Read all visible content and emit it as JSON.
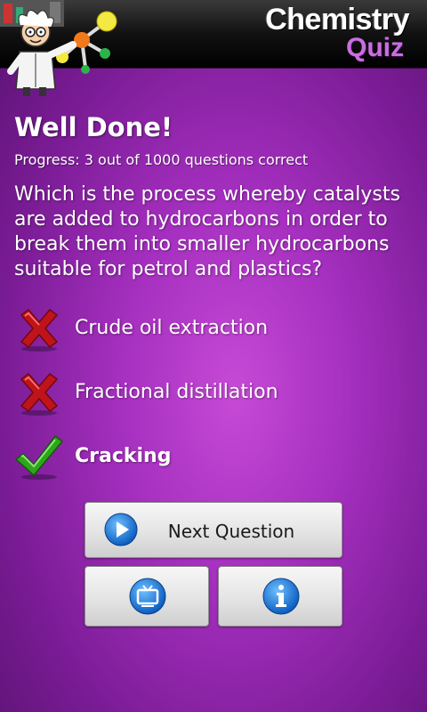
{
  "app": {
    "brand_line1": "Chemistry",
    "brand_line2": "Quiz"
  },
  "result": {
    "title": "Well Done!",
    "progress": "Progress: 3 out of 1000 questions correct"
  },
  "question": {
    "text": "Which is the process whereby catalysts are added to hydrocarbons in order to break them into smaller hydrocarbons suitable for petrol and plastics?"
  },
  "answers": [
    {
      "label": "Crude oil extraction",
      "status": "wrong",
      "icon": "cross-icon"
    },
    {
      "label": "Fractional distillation",
      "status": "wrong",
      "icon": "cross-icon"
    },
    {
      "label": "Cracking",
      "status": "correct",
      "icon": "check-icon"
    }
  ],
  "buttons": {
    "next_label": "Next Question",
    "next_icon": "play-icon",
    "tv_icon": "tv-icon",
    "info_icon": "info-icon"
  },
  "colors": {
    "background": "#a52fbf",
    "brand_accent": "#c96fe0",
    "wrong": "#c0141a",
    "correct": "#2fa51c",
    "icon_blue": "#1a78d8"
  }
}
